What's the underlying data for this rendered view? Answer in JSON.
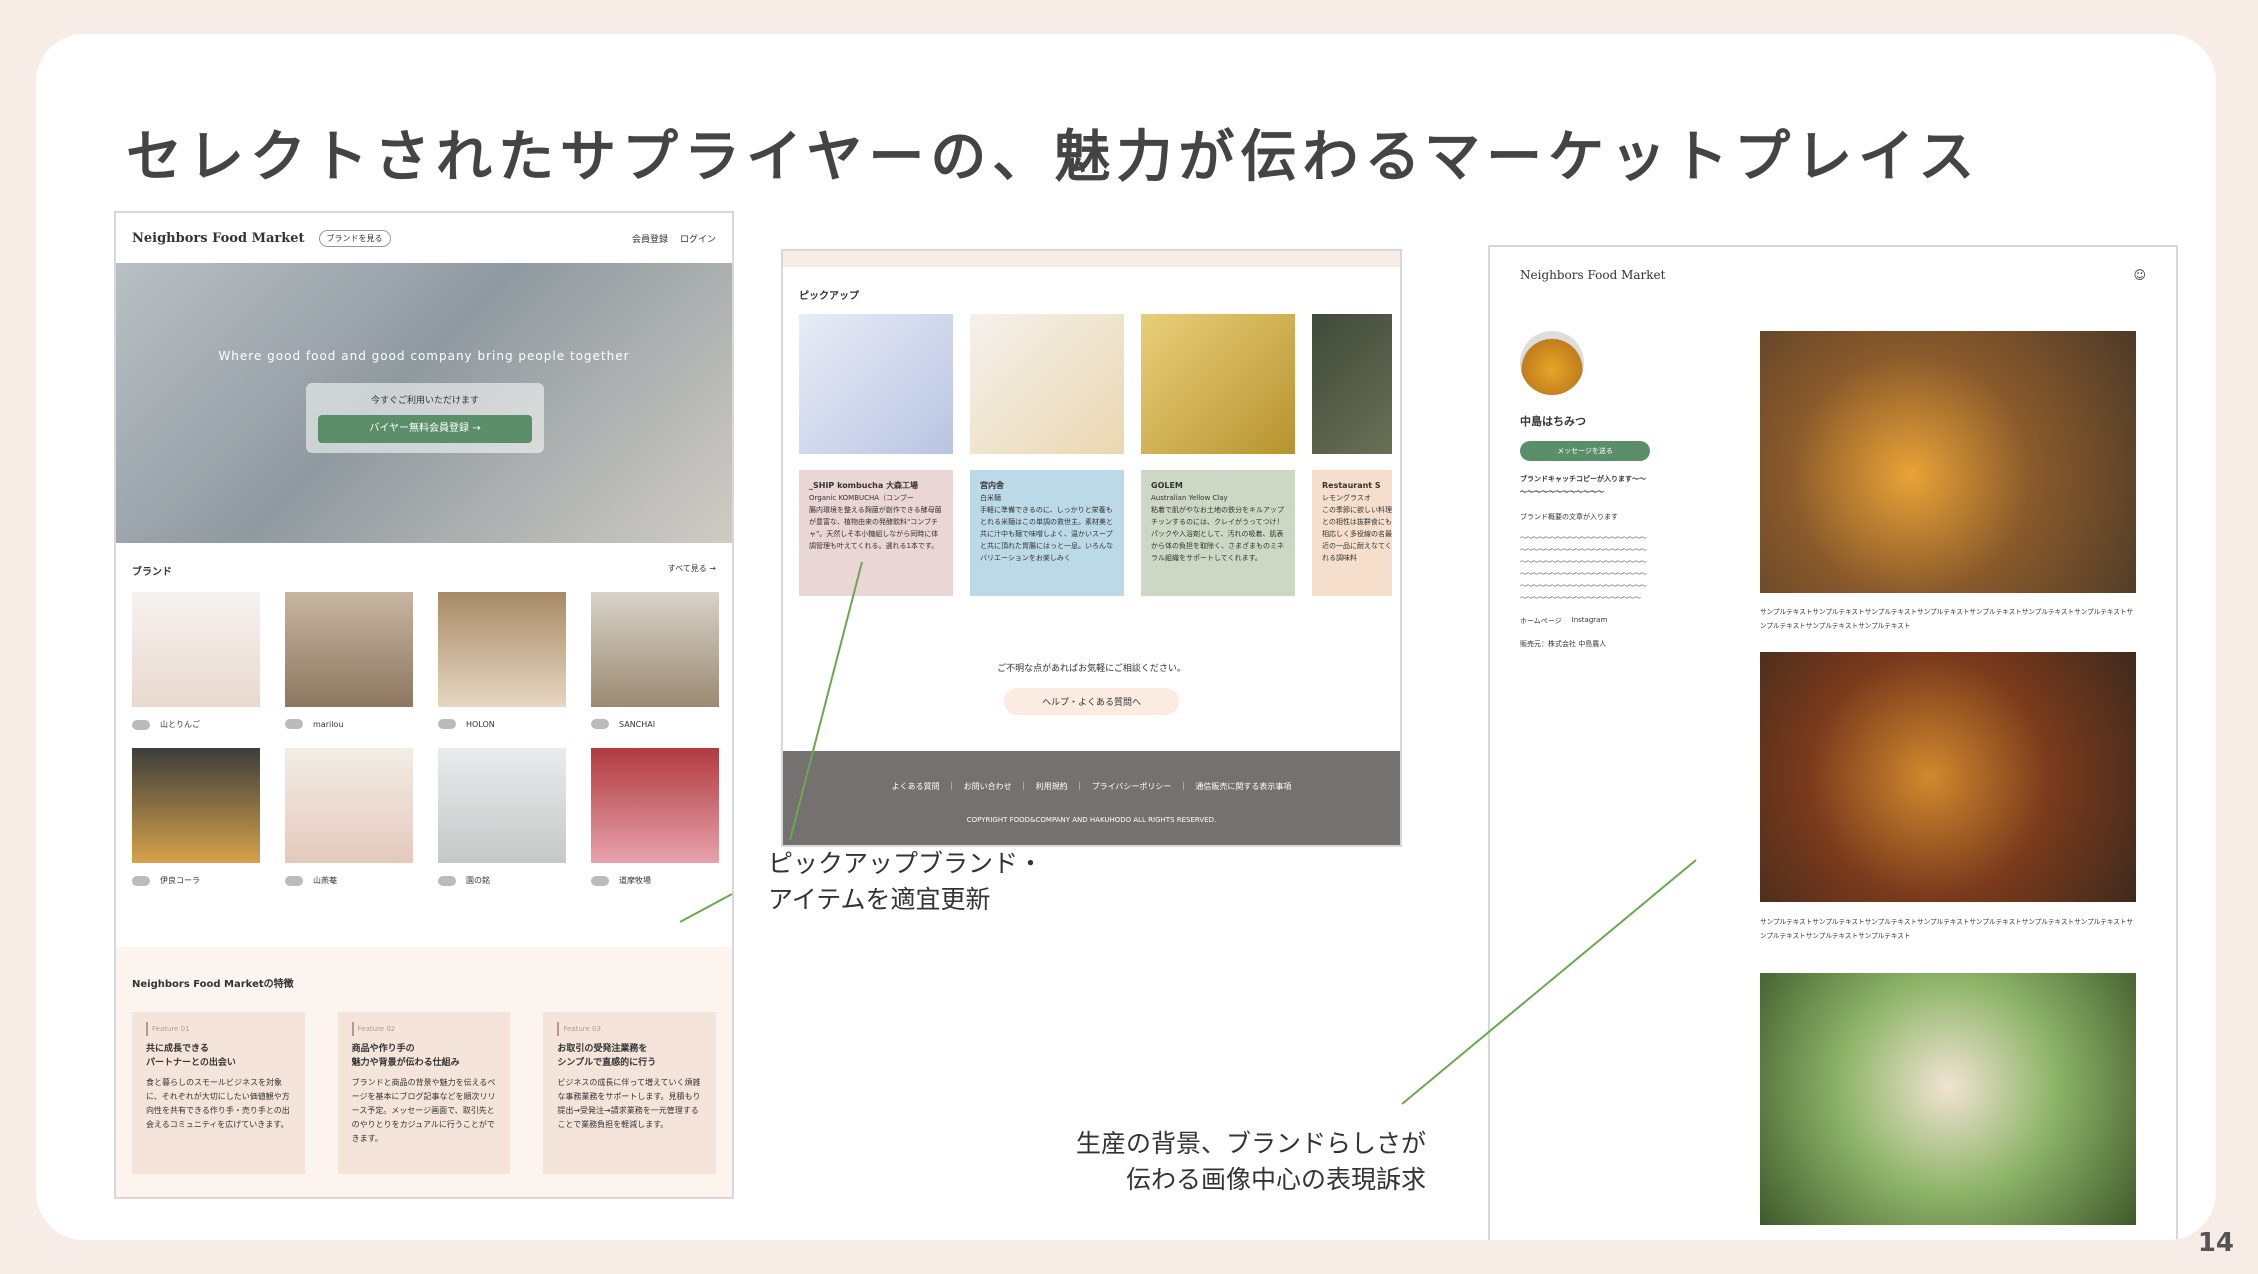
{
  "slide": {
    "title": "セレクトされたサプライヤーの、魅力が伝わるマーケットプレイス",
    "page_number": "14"
  },
  "captions": {
    "pickup": [
      "ピックアップブランド・",
      "アイテムを適宜更新"
    ],
    "image": [
      "生産の背景、ブランドらしさが",
      "伝わる画像中心の表現訴求"
    ]
  },
  "site1": {
    "logo": "Neighbors Food Market",
    "brand_pill": "ブランドを見る",
    "register": "会員登録",
    "login": "ログイン",
    "hero_tagline": "Where good food and good company bring people together",
    "hero_note": "今すぐご利用いただけます",
    "hero_button": "バイヤー無料会員登録 →",
    "brands_title": "ブランド",
    "brands_more": "すべて見る →",
    "brands": [
      {
        "name": "山とりんご"
      },
      {
        "name": "marilou"
      },
      {
        "name": "HOLON"
      },
      {
        "name": "SANCHAI"
      },
      {
        "name": "伊良コーラ"
      },
      {
        "name": "山燕菴"
      },
      {
        "name": "園の銘"
      },
      {
        "name": "道摩牧場"
      }
    ],
    "features_title": "Neighbors Food Marketの特徴",
    "features": [
      {
        "label": "Feature 01",
        "heading": "共に成長できる\nパートナーとの出会い",
        "body": "食と暮らしのスモールビジネスを対象に、それぞれが大切にしたい価値観や方向性を共有できる作り手・売り手との出会えるコミュニティを広げていきます。"
      },
      {
        "label": "Feature 02",
        "heading": "商品や作り手の\n魅力や背景が伝わる仕組み",
        "body": "ブランドと商品の背景や魅力を伝えるページを基本にブログ記事などを順次リリース予定。メッセージ画面で、取引先とのやりとりをカジュアルに行うことができます。"
      },
      {
        "label": "Feature 03",
        "heading": "お取引の受発注業務を\nシンプルで直感的に行う",
        "body": "ビジネスの成長に伴って増えていく煩雑な事務業務をサポートします。見積もり提出→受発注→請求業務を一元管理することで業務負担を軽減します。"
      }
    ]
  },
  "site2": {
    "pickup_title": "ピックアップ",
    "items": [
      {
        "brand": "_SHIP kombucha 大森工場",
        "sub": "Organic KOMBUCHA（コンブー",
        "body": "腸内環境を整える麹菌が創作できる酵母菌が豊富な、植物由来の発酵飲料\"コンブチャ\"。天然しそ本小糖組しながら同時に体調管理も叶えてくれる。選れる1本です。",
        "color": "#ead6d4"
      },
      {
        "brand": "宮内舎",
        "sub": "白米麺",
        "body": "手軽に準備できるのに、しっかりと栄養もとれる米麺はこの単調の救世主。素材美と共に汁中も麺で味噌しよく、温かいスープと共に頂れた胃腸にはっと一息。いろんなバリエーションをお楽しみく",
        "color": "#bcd9e7"
      },
      {
        "brand": "GOLEM",
        "sub": "Australian Yellow Clay",
        "body": "粘着で肌がやなお土地の鉄分をキルアップチッンするのには、クレイがうってつけ！パックや入浴剤として、汚れの吸着、肌表から体の負担を取除く、さまざまものミネラル組織をサポートしてくれます。",
        "color": "#ccd8c3"
      },
      {
        "brand": "Restaurant S",
        "sub": "レモングラスオ",
        "body": "この季節に欲しい料理との相性は抜群食にも相応しく多役線の名最近の一品に耐えなてくれる調味料",
        "color": "#f5dfcc"
      }
    ],
    "help_text": "ご不明な点があればお気軽にご相談ください。",
    "help_button": "ヘルプ・よくある質問へ",
    "footer_links": "よくある質問　｜　お問い合わせ　｜　利用規約　｜　プライバシーポリシー　｜　通信販売に関する表示事項",
    "copyright": "COPYRIGHT FOOD&COMPANY AND HAKUHODO ALL RIGHTS RESERVED."
  },
  "site3": {
    "logo": "Neighbors Food Market",
    "brand_name": "中島はちみつ",
    "message_button": "メッセージを送る",
    "catch": "ブランドキャッチコピーが入ります～～～～～～～～～～～～～～",
    "summary": "ブランド概要の文章が入ります",
    "dummy": "～～～～～～～～～～～～～～～～～～～～～～～～～～～～～～～～～～～～～～～～～～～～～～～～～～～～～～～～～～～～～～～～～～～～～～～～～～～～～～～～～～～～～～～～～～～～～～～～～～～～～～～～～～～～～～～～～～～～～～～～～～～～～",
    "homepage": "ホームページ",
    "instagram": "Instagram",
    "seller": "販売元：株式会社 中島農人",
    "sample_caption": "サンプルテキストサンプルテキストサンプルテキストサンプルテキストサンプルテキストサンプルテキストサンプルテキストサンプルテキストサンプルテキストサンプルテキスト"
  }
}
